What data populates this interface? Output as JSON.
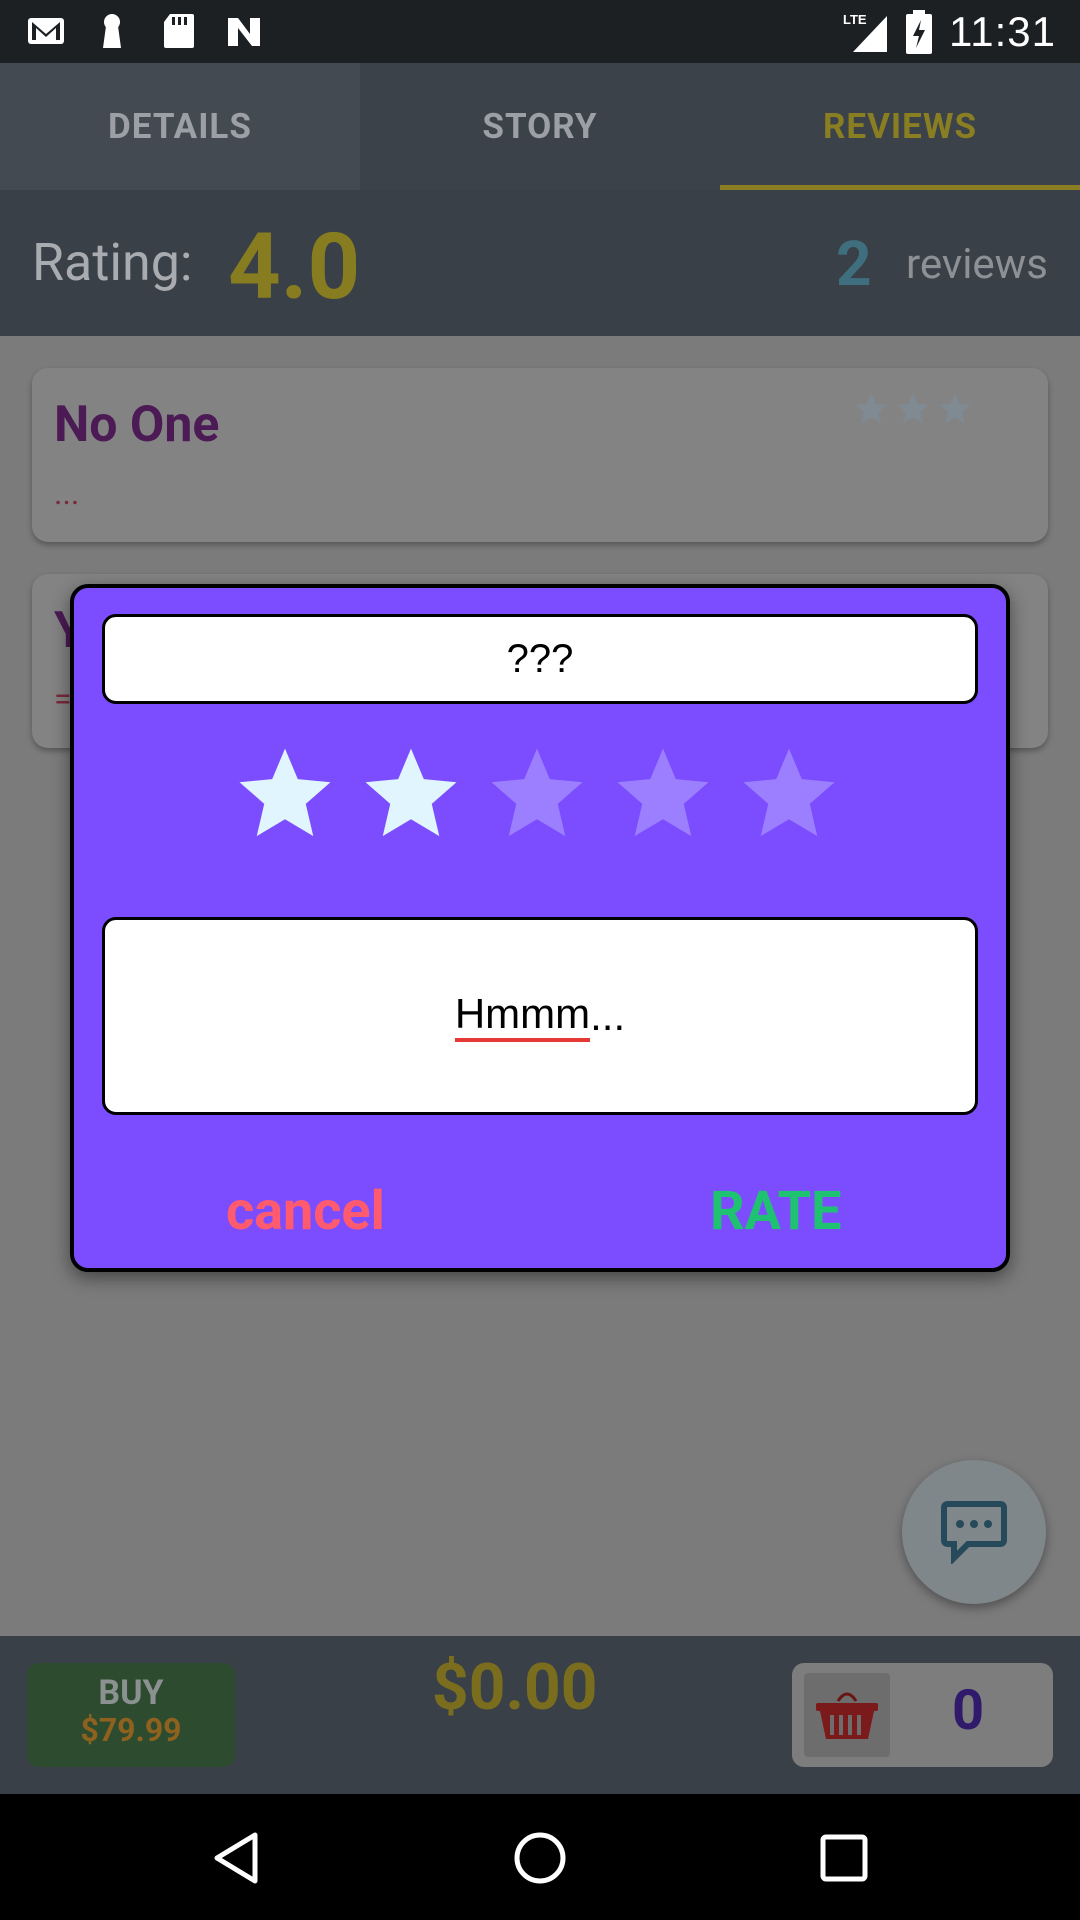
{
  "status_bar": {
    "time": "11:31",
    "network": "LTE"
  },
  "tabs": [
    {
      "label": "DETAILS",
      "active": false
    },
    {
      "label": "STORY",
      "active": false
    },
    {
      "label": "REVIEWS",
      "active": true
    }
  ],
  "rating": {
    "label": "Rating:",
    "value": "4.0",
    "count": "2",
    "count_label": "reviews"
  },
  "reviews": [
    {
      "name": "No One",
      "comment": "...",
      "stars": 3
    },
    {
      "name": "Y",
      "comment": "="
    }
  ],
  "dialog": {
    "title_value": "???",
    "rating": 2,
    "rating_max": 5,
    "review_value": "Hmmm",
    "review_suffix": "...",
    "cancel_label": "cancel",
    "rate_label": "RATE"
  },
  "bottom": {
    "buy_label": "BUY",
    "buy_price": "$79.99",
    "total": "$0.00",
    "cart_count": "0"
  },
  "colors": {
    "dialog_bg": "#7c4dff",
    "accent": "#8a7e22",
    "cancel": "#ff5a6e",
    "rate": "#1ec271"
  }
}
